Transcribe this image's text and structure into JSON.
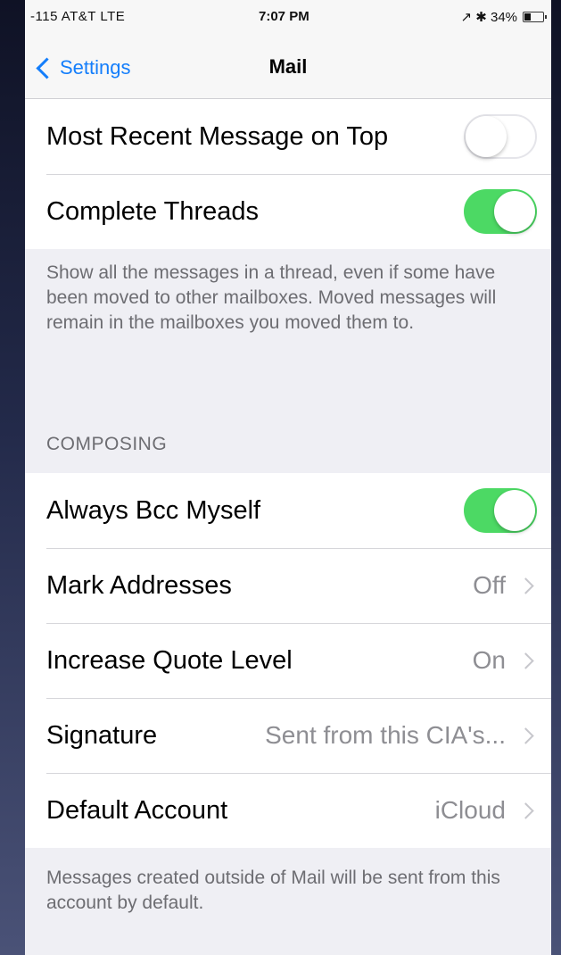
{
  "status_bar": {
    "carrier": "-115 AT&T  LTE",
    "time": "7:07 PM",
    "battery_text": "↗ ✱ 34%",
    "battery_level": 0.34
  },
  "nav": {
    "back_label": "Settings",
    "title": "Mail"
  },
  "threading": {
    "rows": [
      {
        "label": "Most Recent Message on Top",
        "toggle": "off"
      },
      {
        "label": "Complete Threads",
        "toggle": "on"
      }
    ],
    "footer": "Show all the messages in a thread, even if some have been moved to other mailboxes. Moved messages will remain in the mailboxes you moved them to."
  },
  "composing": {
    "header": "COMPOSING",
    "rows": [
      {
        "label": "Always Bcc Myself",
        "toggle": "on"
      },
      {
        "label": "Mark Addresses",
        "value": "Off"
      },
      {
        "label": "Increase Quote Level",
        "value": "On"
      },
      {
        "label": "Signature",
        "value": "Sent from this CIA's..."
      },
      {
        "label": "Default Account",
        "value": "iCloud"
      }
    ],
    "footer": "Messages created outside of Mail will be sent from this account by default."
  },
  "colors": {
    "accent": "#147efb",
    "toggle_on": "#4cd964",
    "background": "#efeff4"
  }
}
